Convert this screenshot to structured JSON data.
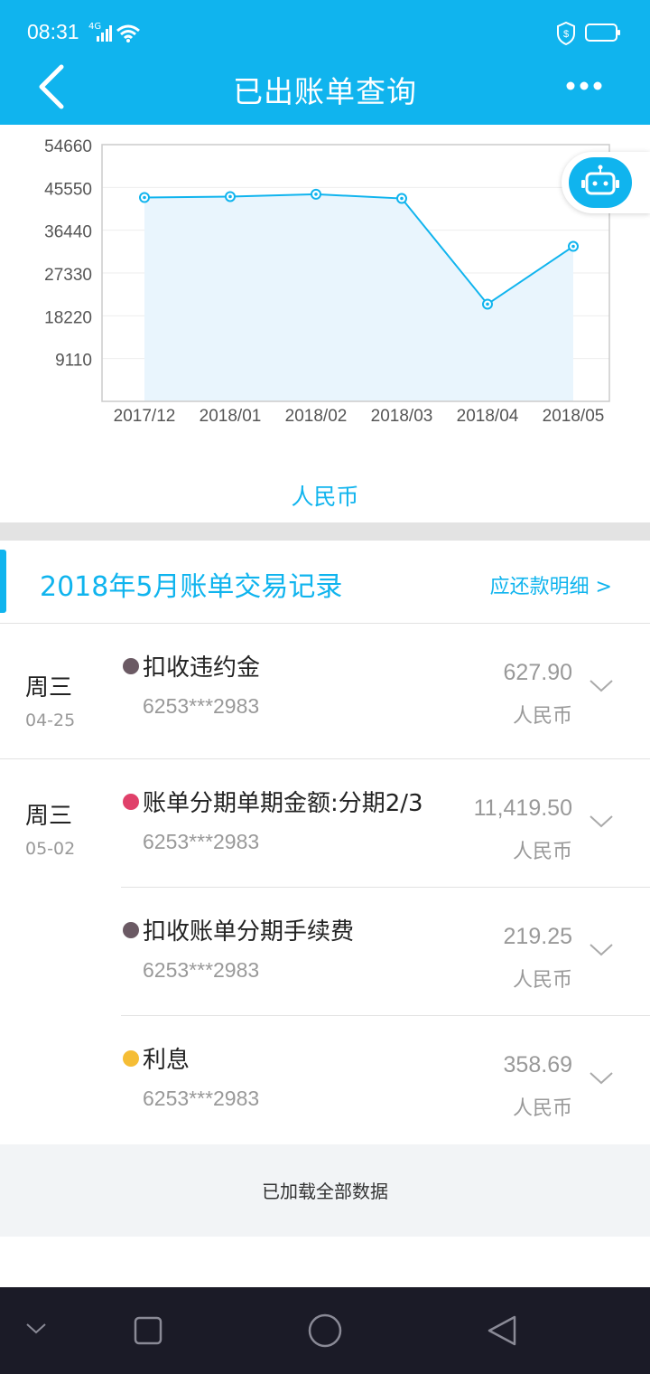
{
  "status_bar": {
    "time": "08:31",
    "network": "4G"
  },
  "header": {
    "title": "已出账单查询"
  },
  "chart_data": {
    "type": "area",
    "categories": [
      "2017/12",
      "2018/01",
      "2018/02",
      "2018/03",
      "2018/04",
      "2018/05"
    ],
    "values": [
      43400,
      43600,
      44100,
      43200,
      20700,
      33000
    ],
    "yticks": [
      "54660",
      "45550",
      "36440",
      "27330",
      "18220",
      "9110"
    ],
    "ylim": [
      0,
      54660
    ],
    "grid": true,
    "line_color": "#10b4ee",
    "fill_color": "#e9f5fd"
  },
  "currency_tab": "人民币",
  "section": {
    "title": "2018年5月账单交易记录",
    "link": "应还款明细 >"
  },
  "days": [
    {
      "weekday": "周三",
      "date": "04-25",
      "transactions": [
        {
          "name": "扣收违约金",
          "card": "6253***2983",
          "amount": "627.90",
          "currency": "人民币",
          "dot_color": "#6b5a64"
        }
      ]
    },
    {
      "weekday": "周三",
      "date": "05-02",
      "transactions": [
        {
          "name": "账单分期单期金额:分期2/3",
          "card": "6253***2983",
          "amount": "11,419.50",
          "currency": "人民币",
          "dot_color": "#e0406a"
        },
        {
          "name": "扣收账单分期手续费",
          "card": "6253***2983",
          "amount": "219.25",
          "currency": "人民币",
          "dot_color": "#6b5a64"
        },
        {
          "name": "利息",
          "card": "6253***2983",
          "amount": "358.69",
          "currency": "人民币",
          "dot_color": "#f5bd35"
        }
      ]
    }
  ],
  "footer": {
    "text": "已加载全部数据"
  },
  "colors": {
    "accent": "#10b4ee",
    "nav_bg": "#1b1b27"
  }
}
